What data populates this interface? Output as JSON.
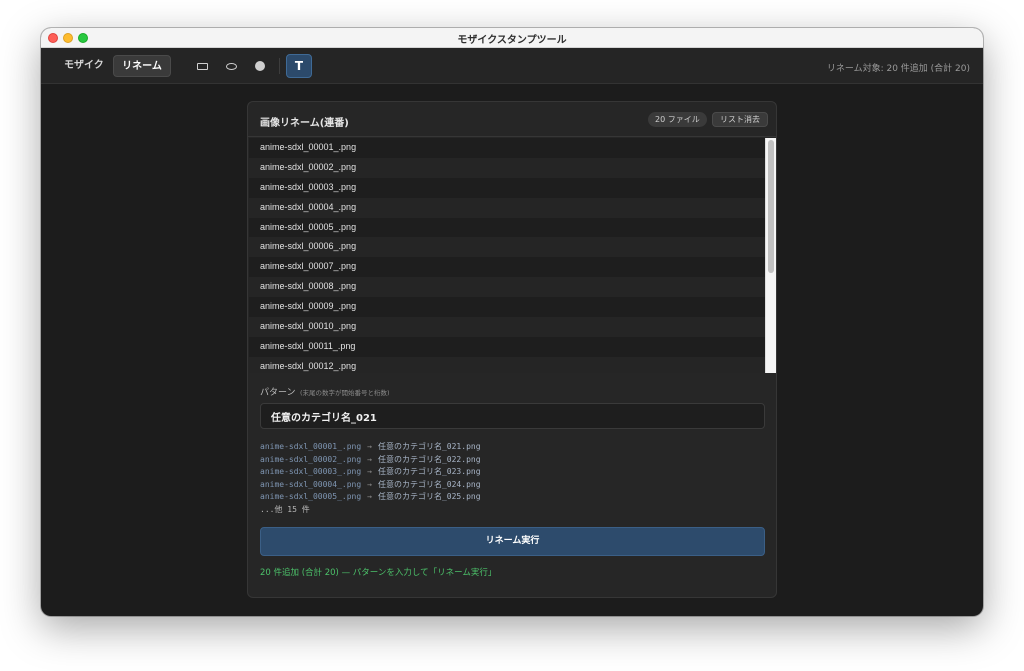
{
  "window": {
    "title": "モザイクスタンプツール"
  },
  "toolbar": {
    "tabs": [
      {
        "label": "モザイク"
      },
      {
        "label": "リネーム"
      }
    ],
    "tools": [
      "rectangle-icon",
      "ellipse-icon",
      "circle-icon"
    ],
    "text_tool_label": "T",
    "status": "リネーム対象: 20 件追加 (合計 20)"
  },
  "panel": {
    "title": "画像リネーム(連番)",
    "file_count_badge": "20 ファイル",
    "clear_button": "リスト消去",
    "files": [
      "anime-sdxl_00001_.png",
      "anime-sdxl_00002_.png",
      "anime-sdxl_00003_.png",
      "anime-sdxl_00004_.png",
      "anime-sdxl_00005_.png",
      "anime-sdxl_00006_.png",
      "anime-sdxl_00007_.png",
      "anime-sdxl_00008_.png",
      "anime-sdxl_00009_.png",
      "anime-sdxl_00010_.png",
      "anime-sdxl_00011_.png",
      "anime-sdxl_00012_.png"
    ],
    "pattern": {
      "label": "パターン",
      "hint": "(末尾の数字が開始番号と桁数)",
      "value": "任意のカテゴリ名_021"
    },
    "preview": [
      {
        "src": "anime-sdxl_00001_.png",
        "arrow": "→",
        "dst": "任意のカテゴリ名_021.png"
      },
      {
        "src": "anime-sdxl_00002_.png",
        "arrow": "→",
        "dst": "任意のカテゴリ名_022.png"
      },
      {
        "src": "anime-sdxl_00003_.png",
        "arrow": "→",
        "dst": "任意のカテゴリ名_023.png"
      },
      {
        "src": "anime-sdxl_00004_.png",
        "arrow": "→",
        "dst": "任意のカテゴリ名_024.png"
      },
      {
        "src": "anime-sdxl_00005_.png",
        "arrow": "→",
        "dst": "任意のカテゴリ名_025.png"
      }
    ],
    "preview_more": "...他 15 件",
    "execute_button": "リネーム実行",
    "status_message": "20 件追加 (合計 20) — パターンを入力して「リネーム実行」"
  },
  "colors": {
    "accent": "#2d4b6c",
    "success": "#4cc26a",
    "background": "#1c1c1c"
  }
}
